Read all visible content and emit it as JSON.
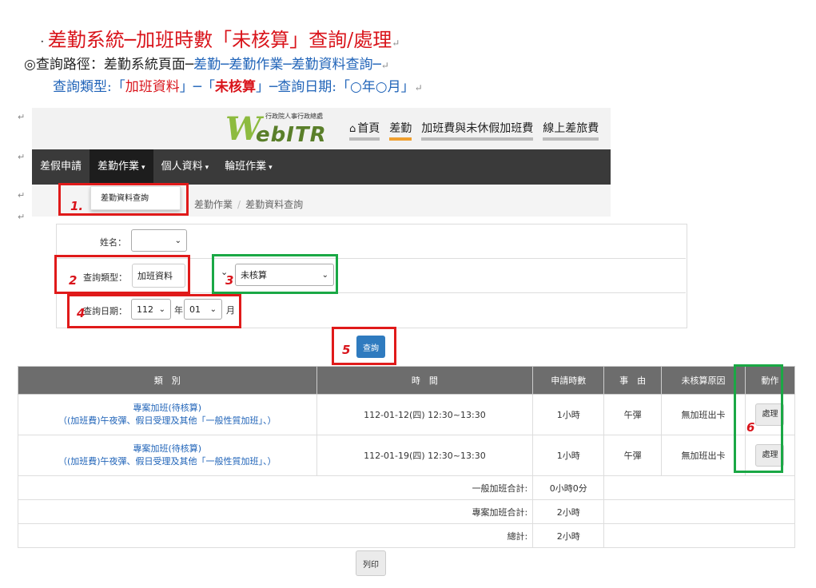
{
  "doc": {
    "title_bullet": "·",
    "title": "差勤系統─加班時數「未核算」查詢/處理",
    "path_prefix": "◎查詢路徑：差勤系統頁面─",
    "path_link": "差勤─差勤作業─差勤資料查詢─",
    "type_prefix": "查詢類型:「",
    "type_data": "加班資料",
    "type_mid1": "」─「",
    "type_status": "未核算",
    "type_mid2": "」─查詢日期:「",
    "type_date": "○年○月",
    "type_end": "」",
    "para_mark": "↵"
  },
  "header": {
    "logo_small": "行政院人事行政總處",
    "logo_w": "W",
    "logo_rest": "ebITR",
    "nav": [
      {
        "label": "首頁",
        "icon": "home-icon"
      },
      {
        "label": "差勤"
      },
      {
        "label": "加班費與未休假加班費"
      },
      {
        "label": "線上差旅費"
      }
    ]
  },
  "menu": {
    "items": [
      {
        "label": "差假申請"
      },
      {
        "label": "差勤作業"
      },
      {
        "label": "個人資料"
      },
      {
        "label": "輪班作業"
      }
    ],
    "dropdown_item": "差勤資料查詢",
    "breadcrumb": [
      "差勤作業",
      "差勤資料查詢"
    ],
    "breadcrumb_sep": "/"
  },
  "form": {
    "name_label": "姓名：",
    "type_label": "查詢類型：",
    "type_value": "加班資料",
    "status_value": "未核算",
    "date_label": "查詢日期：",
    "year_value": "112",
    "year_unit": "年",
    "month_value": "01",
    "month_unit": "月",
    "query_button": "查詢"
  },
  "table": {
    "headers": [
      "類　別",
      "時　間",
      "申請時數",
      "事　由",
      "未核算原因",
      "動作"
    ],
    "rows": [
      {
        "cat1": "專案加班(待核算)",
        "cat2": "（(加班費)午夜彈、假日受理及其他「一般性質加班」、）",
        "time": "112-01-12(四) 12:30~13:30",
        "hours": "1小時",
        "reason": "午彈",
        "uncalc": "無加班出卡",
        "action": "處理"
      },
      {
        "cat1": "專案加班(待核算)",
        "cat2": "（(加班費)午夜彈、假日受理及其他「一般性質加班」、）",
        "time": "112-01-19(四) 12:30~13:30",
        "hours": "1小時",
        "reason": "午彈",
        "uncalc": "無加班出卡",
        "action": "處理"
      }
    ],
    "sums": [
      {
        "label": "一般加班合計:",
        "value": "0小時0分"
      },
      {
        "label": "專案加班合計:",
        "value": "2小時"
      },
      {
        "label": "總計:",
        "value": "2小時"
      }
    ],
    "print_button": "列印"
  },
  "annotations": [
    "1.",
    "2",
    "3",
    "4",
    "5",
    "6"
  ],
  "colors": {
    "annotation_red": "#e01a1a",
    "annotation_green": "#1aa845",
    "menubar": "#3a3a3a",
    "query_button": "#2f7bbf"
  }
}
